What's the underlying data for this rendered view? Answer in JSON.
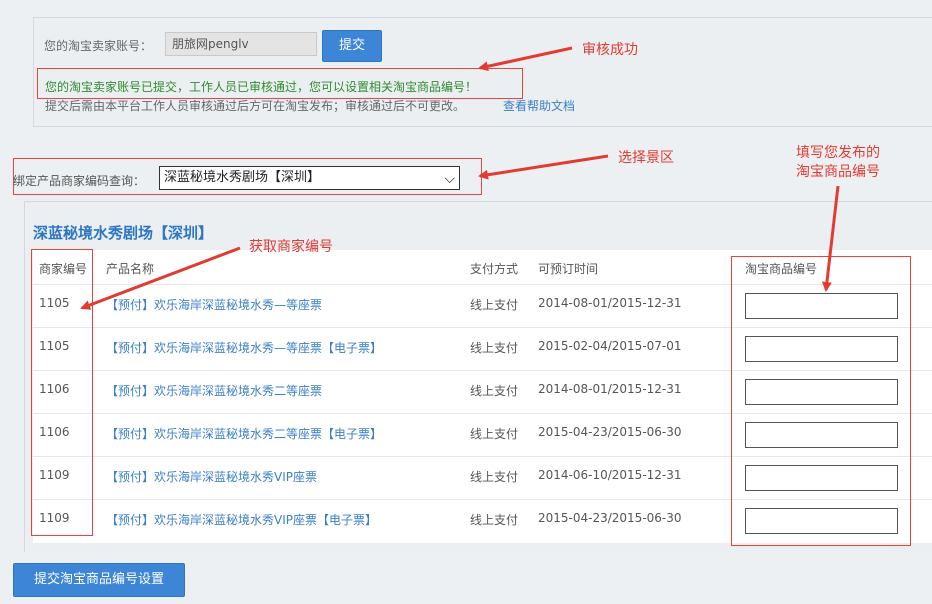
{
  "account": {
    "label": "您的淘宝卖家账号：",
    "value": "朋旅网penglv",
    "submit_label": "提交",
    "success_message": "您的淘宝卖家账号已提交，工作人员已审核通过，您可以设置相关淘宝商品编号！",
    "note": "提交后需由本平台工作人员审核通过后方可在淘宝发布；审核通过后不可更改。",
    "help_link": "查看帮助文档"
  },
  "binding": {
    "label": "绑定产品商家编码查询：",
    "selected": "深蓝秘境水秀剧场【深圳】"
  },
  "products": {
    "title": "深蓝秘境水秀剧场【深圳】",
    "columns": [
      "商家编号",
      "产品名称",
      "支付方式",
      "可预订时间",
      "淘宝商品编号"
    ],
    "rows": [
      {
        "code": "1105",
        "name": "【预付】欢乐海岸深蓝秘境水秀—等座票",
        "pay": "线上支付",
        "dates": "2014-08-01/2015-12-31"
      },
      {
        "code": "1105",
        "name": "【预付】欢乐海岸深蓝秘境水秀—等座票【电子票】",
        "pay": "线上支付",
        "dates": "2015-02-04/2015-07-01"
      },
      {
        "code": "1106",
        "name": "【预付】欢乐海岸深蓝秘境水秀二等座票",
        "pay": "线上支付",
        "dates": "2014-08-01/2015-12-31"
      },
      {
        "code": "1106",
        "name": "【预付】欢乐海岸深蓝秘境水秀二等座票【电子票】",
        "pay": "线上支付",
        "dates": "2015-04-23/2015-06-30"
      },
      {
        "code": "1109",
        "name": "【预付】欢乐海岸深蓝秘境水秀VIP座票",
        "pay": "线上支付",
        "dates": "2014-06-10/2015-12-31"
      },
      {
        "code": "1109",
        "name": "【预付】欢乐海岸深蓝秘境水秀VIP座票【电子票】",
        "pay": "线上支付",
        "dates": "2015-04-23/2015-06-30"
      }
    ]
  },
  "footer": {
    "submit_label": "提交淘宝商品编号设置"
  },
  "annotations": {
    "approved": "审核成功",
    "select_area": "选择景区",
    "fill_number_line1": "填写您发布的",
    "fill_number_line2": "淘宝商品编号",
    "get_code": "获取商家编号"
  },
  "colors": {
    "accent": "#3d86d7",
    "annotation": "#e23b32",
    "success": "#2f8a2f",
    "link": "#3d7fc5"
  }
}
